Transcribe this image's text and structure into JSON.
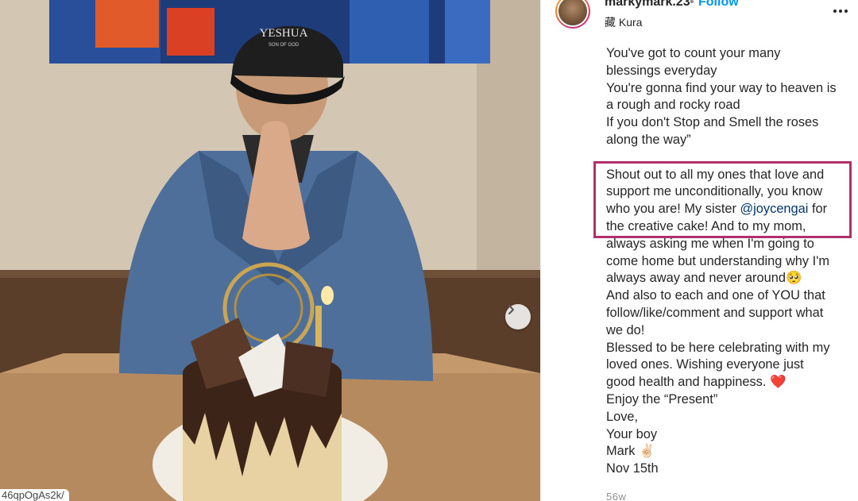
{
  "post": {
    "username": "markymark.23",
    "separator": "•",
    "follow_label": "Follow",
    "location": "藏 Kura",
    "more_icon": "more-horizontal-icon",
    "caption_lines_1": [
      "You've got to count your many",
      "blessings everyday",
      "You're gonna find your way to heaven is",
      "a rough and rocky road",
      "If you don't Stop and Smell the roses",
      "along the way”"
    ],
    "shoutout_1": "Shout out to all my ones that love and",
    "shoutout_2": "support me unconditionally, you know",
    "shoutout_3a": "who you are! My sister ",
    "mention": "@joycengai",
    "shoutout_3b": " for",
    "shoutout_4": "the creative cake! And to my mom,",
    "caption_lines_2": [
      "always asking me when I'm going to",
      "come home but understanding why I'm",
      "always away and never around🥺",
      "And also to each and one of YOU that",
      "follow/like/comment and support what",
      "we do!",
      "Blessed to be here celebrating with my",
      "loved ones. Wishing everyone just",
      "good health and happiness. ❤️",
      "Enjoy the “Present”",
      "Love,",
      "Your boy",
      "Mark ✌🏻",
      "Nov 15th"
    ],
    "timestamp": "56w"
  },
  "photo": {
    "cap_text": "YESHUA",
    "cap_subtext": "SON OF GOD",
    "url_fragment": "46qpOgAs2k/"
  },
  "colors": {
    "highlight_border": "#b0306a",
    "follow_blue": "#0095f6",
    "mention": "#00376b"
  }
}
